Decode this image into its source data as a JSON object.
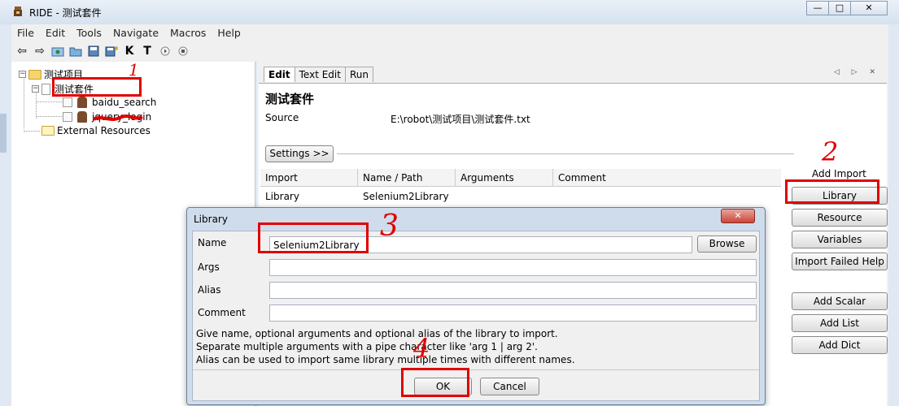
{
  "window": {
    "title": "RIDE - 测试套件",
    "controls": [
      "—",
      "□",
      "✕"
    ]
  },
  "menu": [
    "File",
    "Edit",
    "Tools",
    "Navigate",
    "Macros",
    "Help"
  ],
  "toolbar": {
    "icons": [
      "back-arrow-icon",
      "forward-arrow-icon",
      "open-suite-icon",
      "open-directory-icon",
      "save-icon",
      "save-all-icon",
      "search-keywords-icon",
      "search-tests-icon",
      "run-icon",
      "stop-icon"
    ],
    "k_label": "K",
    "t_label": "T"
  },
  "tree": {
    "project": "测试项目",
    "suite": "测试套件",
    "tests": [
      "baidu_search",
      "jquery_login"
    ],
    "external": "External Resources",
    "expander_minus": "−"
  },
  "editor": {
    "tabs": [
      "Edit",
      "Text Edit",
      "Run"
    ],
    "tab_nav": "◁ ▷ ✕",
    "suite_name": "测试套件",
    "source_label": "Source",
    "source_path": "E:\\robot\\测试项目\\测试套件.txt",
    "settings_button": "Settings >>",
    "import_table": {
      "headers": [
        "Import",
        "Name / Path",
        "Arguments",
        "Comment"
      ],
      "rows": [
        [
          "Library",
          "Selenium2Library",
          "",
          ""
        ]
      ]
    },
    "add_import_label": "Add Import",
    "buttons": {
      "library": "Library",
      "resource": "Resource",
      "variables": "Variables",
      "import_failed_help": "Import Failed Help",
      "add_scalar": "Add Scalar",
      "add_list": "Add List",
      "add_dict": "Add Dict"
    }
  },
  "dialog": {
    "title": "Library",
    "close": "✕",
    "name_label": "Name",
    "name_value": "Selenium2Library",
    "browse": "Browse",
    "args_label": "Args",
    "alias_label": "Alias",
    "comment_label": "Comment",
    "help": [
      "Give name, optional arguments and optional alias of the library to import.",
      "Separate multiple arguments with a pipe character like 'arg 1 | arg 2'.",
      "Alias can be used to import same library multiple times with different names."
    ],
    "ok": "OK",
    "cancel": "Cancel"
  },
  "annotations": {
    "color": "#e00000",
    "marks": [
      "1",
      "2",
      "3",
      "4"
    ]
  }
}
